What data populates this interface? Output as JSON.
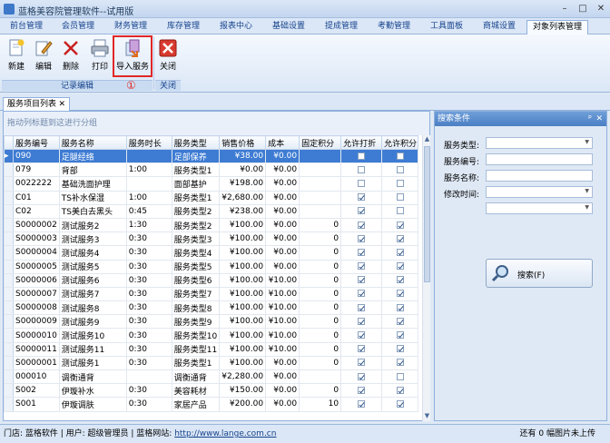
{
  "window": {
    "title": "蓝格美容院管理软件--试用版",
    "min": "–",
    "max": "□",
    "close": "✕"
  },
  "menu": [
    "前台管理",
    "会员管理",
    "财务管理",
    "库存管理",
    "报表中心",
    "基础设置",
    "提成管理",
    "考勤管理",
    "工具面板",
    "商城设置",
    "对象列表管理"
  ],
  "ribbon": {
    "buttons": [
      {
        "label": "新建",
        "icon": "new-doc-icon"
      },
      {
        "label": "编辑",
        "icon": "edit-pencil-icon"
      },
      {
        "label": "删除",
        "icon": "delete-x-icon"
      },
      {
        "label": "打印",
        "icon": "printer-icon"
      },
      {
        "label": "导入服务",
        "icon": "import-icon"
      },
      {
        "label": "关闭",
        "icon": "close-red-icon"
      }
    ],
    "groups": [
      "记录编辑",
      "关闭"
    ],
    "annotation": "①"
  },
  "doc_tab": {
    "label": "服务项目列表",
    "close": "✕"
  },
  "grid": {
    "group_hint": "拖动列标题到这进行分组",
    "columns": [
      "服务编号",
      "服务名称",
      "服务时长",
      "服务类型",
      "销售价格",
      "成本",
      "固定积分",
      "允许打折",
      "允许积分"
    ],
    "rows": [
      {
        "c": [
          "090",
          "足腿经络",
          "",
          "足部保养",
          "¥38.00",
          "¥0.00",
          ""
        ],
        "d": false,
        "p": false
      },
      {
        "c": [
          "079",
          "背部",
          "1:00",
          "服务类型1",
          "¥0.00",
          "¥0.00",
          ""
        ],
        "d": false,
        "p": false
      },
      {
        "c": [
          "0022222",
          "基础洗面护理",
          "",
          "面部基护",
          "¥198.00",
          "¥0.00",
          ""
        ],
        "d": false,
        "p": false
      },
      {
        "c": [
          "C01",
          "TS补水保湿",
          "1:00",
          "服务类型1",
          "¥2,680.00",
          "¥0.00",
          ""
        ],
        "d": true,
        "p": false
      },
      {
        "c": [
          "C02",
          "TS美白去黑头",
          "0:45",
          "服务类型2",
          "¥238.00",
          "¥0.00",
          ""
        ],
        "d": true,
        "p": false
      },
      {
        "c": [
          "S0000002",
          "测试服务2",
          "1:30",
          "服务类型2",
          "¥100.00",
          "¥0.00",
          "0"
        ],
        "d": true,
        "p": true
      },
      {
        "c": [
          "S0000003",
          "测试服务3",
          "0:30",
          "服务类型3",
          "¥100.00",
          "¥0.00",
          "0"
        ],
        "d": true,
        "p": true
      },
      {
        "c": [
          "S0000004",
          "测试服务4",
          "0:30",
          "服务类型4",
          "¥100.00",
          "¥0.00",
          "0"
        ],
        "d": true,
        "p": true
      },
      {
        "c": [
          "S0000005",
          "测试服务5",
          "0:30",
          "服务类型5",
          "¥100.00",
          "¥0.00",
          "0"
        ],
        "d": true,
        "p": true
      },
      {
        "c": [
          "S0000006",
          "测试服务6",
          "0:30",
          "服务类型6",
          "¥100.00",
          "¥10.00",
          "0"
        ],
        "d": true,
        "p": true
      },
      {
        "c": [
          "S0000007",
          "测试服务7",
          "0:30",
          "服务类型7",
          "¥100.00",
          "¥10.00",
          "0"
        ],
        "d": true,
        "p": true
      },
      {
        "c": [
          "S0000008",
          "测试服务8",
          "0:30",
          "服务类型8",
          "¥100.00",
          "¥10.00",
          "0"
        ],
        "d": true,
        "p": true
      },
      {
        "c": [
          "S0000009",
          "测试服务9",
          "0:30",
          "服务类型9",
          "¥100.00",
          "¥10.00",
          "0"
        ],
        "d": true,
        "p": true
      },
      {
        "c": [
          "S0000010",
          "测试服务10",
          "0:30",
          "服务类型10",
          "¥100.00",
          "¥10.00",
          "0"
        ],
        "d": true,
        "p": true
      },
      {
        "c": [
          "S0000011",
          "测试服务11",
          "0:30",
          "服务类型11",
          "¥100.00",
          "¥10.00",
          "0"
        ],
        "d": true,
        "p": true
      },
      {
        "c": [
          "S0000001",
          "测试服务1",
          "0:30",
          "服务类型1",
          "¥100.00",
          "¥0.00",
          "0"
        ],
        "d": true,
        "p": true
      },
      {
        "c": [
          "000010",
          "调衡通背",
          "",
          "调衡通背",
          "¥2,280.00",
          "¥0.00",
          ""
        ],
        "d": true,
        "p": false
      },
      {
        "c": [
          "S002",
          "伊璇补水",
          "0:30",
          "美容耗材",
          "¥150.00",
          "¥0.00",
          "0"
        ],
        "d": true,
        "p": true
      },
      {
        "c": [
          "S001",
          "伊璇调肤",
          "0:30",
          "家居产品",
          "¥200.00",
          "¥0.00",
          "10"
        ],
        "d": true,
        "p": true
      }
    ]
  },
  "search_panel": {
    "title": "搜索条件",
    "pin": "ᵖ",
    "close": "✕",
    "fields": [
      {
        "label": "服务类型:",
        "dropdown": true
      },
      {
        "label": "服务编号:",
        "dropdown": false
      },
      {
        "label": "服务名称:",
        "dropdown": false
      },
      {
        "label": "修改时间:",
        "dropdown": true
      },
      {
        "label": "",
        "dropdown": true
      }
    ],
    "search_button": "搜索(F)"
  },
  "status": {
    "left": "门店: 蓝格软件  |  用户: 超级管理员  |  蓝格网站:",
    "link": "http://www.lange.com.cn",
    "right": "还有 0 幅图片未上传"
  },
  "colors": {
    "selection": "#3e7cd3",
    "accent": "#15428b",
    "highlight": "#e02828"
  }
}
